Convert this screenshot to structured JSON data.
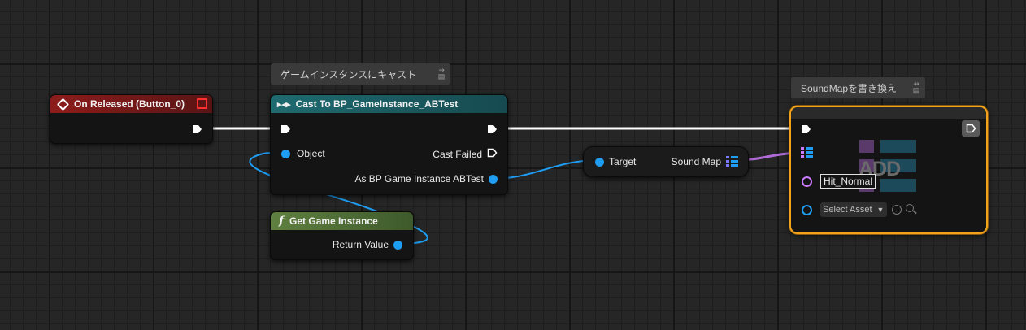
{
  "colors": {
    "exec_wire": "#ffffff",
    "object_wire": "#1e9df2",
    "map_wire": "#b06ad6",
    "event_header": "#8c1c1c",
    "cast_header": "#1c5f63",
    "func_header": "#5a7a3a",
    "selected_outline": "#f3a21b",
    "object_pin": "#1e9df2",
    "map_pin": "#9a5fe0"
  },
  "event_node": {
    "title": "On Released (Button_0)",
    "icon": "event-diamond-icon"
  },
  "cast_comment": "ゲームインスタンスにキャスト",
  "cast_node": {
    "title": "Cast To BP_GameInstance_ABTest",
    "input_object_label": "Object",
    "cast_failed_label": "Cast Failed",
    "output_label": "As BP Game Instance ABTest"
  },
  "get_game_instance": {
    "title": "Get Game Instance",
    "return_label": "Return Value",
    "icon": "function-f-icon"
  },
  "soundmap_getter": {
    "target_label": "Target",
    "output_label": "Sound Map"
  },
  "add_comment": "SoundMapを書き換え",
  "add_node": {
    "watermark": "ADD",
    "key_value": "Hit_Normal",
    "asset_select_label": "Select Asset"
  }
}
